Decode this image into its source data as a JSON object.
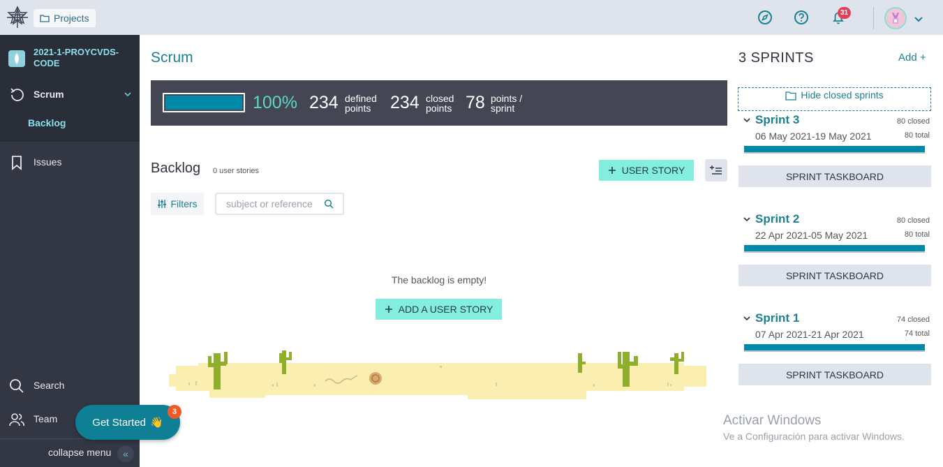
{
  "topbar": {
    "projects_label": "Projects",
    "notifications_count": "31",
    "icons": [
      "taiga-logo-icon",
      "folder-icon",
      "compass-icon",
      "help-icon",
      "bell-icon",
      "avatar",
      "chevron-down-icon"
    ]
  },
  "sidebar": {
    "project_name": "2021-1-PROYCVDS-CODE",
    "scrum_label": "Scrum",
    "backlog_label": "Backlog",
    "issues_label": "Issues",
    "search_label": "Search",
    "team_label": "Team",
    "collapse_label": "collapse menu"
  },
  "get_started": {
    "label": "Get Started",
    "emoji": "👋",
    "badge": "3"
  },
  "main": {
    "title": "Scrum",
    "summary": {
      "progress_percent": 100,
      "percent_label": "100%",
      "defined_points": "234",
      "defined_label_1": "defined",
      "defined_label_2": "points",
      "closed_points": "234",
      "closed_label_1": "closed",
      "closed_label_2": "points",
      "points_per_sprint": "78",
      "pps_label_1": "points /",
      "pps_label_2": "sprint"
    },
    "backlog_title": "Backlog",
    "backlog_count": "0 user stories",
    "user_story_button": "USER STORY",
    "filters_label": "Filters",
    "search_placeholder": "subject or reference",
    "empty_message": "The backlog is empty!",
    "add_story_button": "ADD A USER STORY"
  },
  "sprints_panel": {
    "title": "3 SPRINTS",
    "add_label": "Add",
    "hide_closed_label": "Hide closed sprints",
    "sprints": [
      {
        "name": "Sprint 3",
        "dates": "06 May 2021-19 May 2021",
        "closed": "80 closed",
        "total": "80 total",
        "progress": 1.0,
        "button": "SPRINT TASKBOARD"
      },
      {
        "name": "Sprint 2",
        "dates": "22 Apr 2021-05 May 2021",
        "closed": "80 closed",
        "total": "80 total",
        "progress": 1.0,
        "button": "SPRINT TASKBOARD"
      },
      {
        "name": "Sprint 1",
        "dates": "07 Apr 2021-21 Apr 2021",
        "closed": "74 closed",
        "total": "74 total",
        "progress": 1.0,
        "button": "SPRINT TASKBOARD"
      }
    ]
  },
  "windows_watermark": {
    "title": "Activar Windows",
    "subtitle": "Ve a Configuración para activar Windows."
  },
  "colors": {
    "accent": "#1b7f92",
    "progress": "#008aa8",
    "button_mint": "#83eede",
    "sidebar": "#323743",
    "summary_bar": "#444653"
  }
}
